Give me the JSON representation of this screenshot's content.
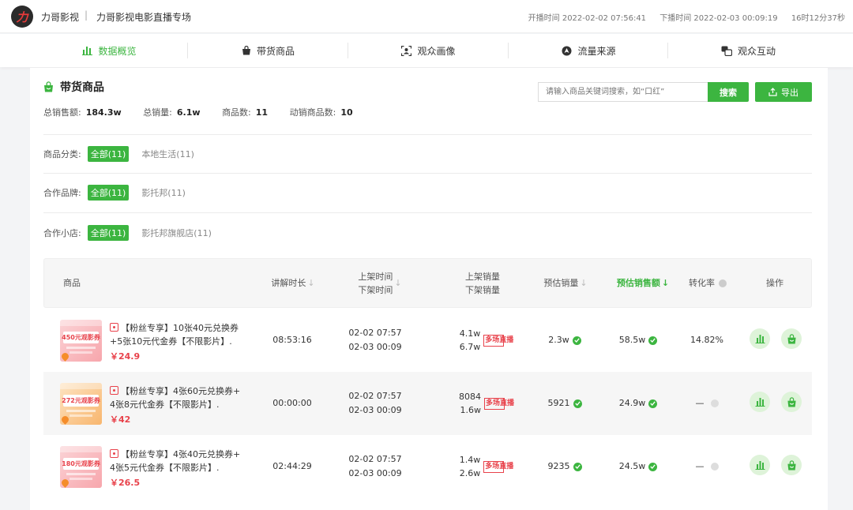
{
  "header": {
    "anchor_name": "力哥影视",
    "separator": "|",
    "live_title": "力哥影视电影直播专场",
    "start_time": "开播时间 2022-02-02 07:56:41",
    "end_time": "下播时间 2022-02-03 00:09:19",
    "duration": "16时12分37秒"
  },
  "nav": {
    "tabs": [
      {
        "label": "数据概览",
        "icon": "bar-chart-icon",
        "active": true
      },
      {
        "label": "带货商品",
        "icon": "shopping-bag-icon",
        "active": false
      },
      {
        "label": "观众画像",
        "icon": "user-portrait-icon",
        "active": false
      },
      {
        "label": "流量来源",
        "icon": "compass-icon",
        "active": false
      },
      {
        "label": "观众互动",
        "icon": "interaction-icon",
        "active": false
      }
    ],
    "active_color": "#3cb540"
  },
  "section": {
    "title": "带货商品",
    "stats": [
      {
        "label": "总销售额:",
        "value": "184.3w"
      },
      {
        "label": "总销量:",
        "value": "6.1w"
      },
      {
        "label": "商品数:",
        "value": "11"
      },
      {
        "label": "动销商品数:",
        "value": "10"
      }
    ],
    "search_placeholder": "请输入商品关键词搜索，如“口红”",
    "search_label": "搜索",
    "export_label": "导出"
  },
  "filters": [
    {
      "label": "商品分类:",
      "selected": "全部(11)",
      "option": "本地生活(11)"
    },
    {
      "label": "合作品牌:",
      "selected": "全部(11)",
      "option": "影托邦(11)"
    },
    {
      "label": "合作小店:",
      "selected": "全部(11)",
      "option": "影托邦旗舰店(11)"
    }
  ],
  "table": {
    "headers": {
      "product": "商品",
      "duration": "讲解时长",
      "on_shelf": "上架时间",
      "off_shelf": "下架时间",
      "on_volume": "上架销量",
      "off_volume": "下架销量",
      "est_volume": "预估销量",
      "est_sales": "预估销售额",
      "conversion": "转化率",
      "action": "操作"
    },
    "rows": [
      {
        "thumb_text": "450元观影券",
        "title_line1": "【粉丝专享】10张40元兑换券",
        "title_line2": "+5张10元代金券【不限影片】.",
        "price": "￥24.9",
        "duration": "08:53:16",
        "on_time": "02-02 07:57",
        "off_time": "02-03 00:09",
        "on_volume": "4.1w",
        "off_volume": "6.7w",
        "badge": "多场直播",
        "est_volume": "2.3w",
        "est_sales": "58.5w",
        "conversion": "14.82%"
      },
      {
        "thumb_text": "272元观影券",
        "title_line1": "【粉丝专享】4张60元兑换券+",
        "title_line2": "4张8元代金券【不限影片】.",
        "price": "￥42",
        "duration": "00:00:00",
        "on_time": "02-02 07:57",
        "off_time": "02-03 00:09",
        "on_volume": "8084",
        "off_volume": "1.6w",
        "badge": "多场直播",
        "est_volume": "5921",
        "est_sales": "24.9w",
        "conversion": "—"
      },
      {
        "thumb_text": "180元观影券",
        "title_line1": "【粉丝专享】4张40元兑换券+",
        "title_line2": "4张5元代金券【不限影片】.",
        "price": "￥26.5",
        "duration": "02:44:29",
        "on_time": "02-02 07:57",
        "off_time": "02-03 00:09",
        "on_volume": "1.4w",
        "off_volume": "2.6w",
        "badge": "多场直播",
        "est_volume": "9235",
        "est_sales": "24.5w",
        "conversion": "—"
      }
    ]
  }
}
